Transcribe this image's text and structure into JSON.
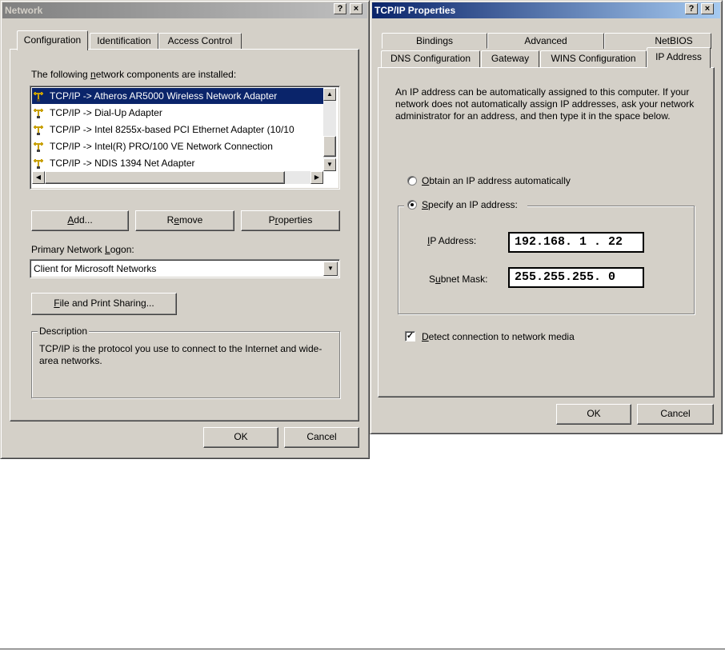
{
  "network": {
    "title": "Network",
    "tabs": [
      "Configuration",
      "Identification",
      "Access Control"
    ],
    "installed_label": "The following network components are installed:",
    "components": [
      "TCP/IP -> Atheros AR5000 Wireless Network Adapter",
      "TCP/IP -> Dial-Up Adapter",
      "TCP/IP -> Intel 8255x-based PCI Ethernet Adapter (10/10",
      "TCP/IP -> Intel(R) PRO/100 VE Network Connection",
      "TCP/IP -> NDIS 1394 Net Adapter"
    ],
    "add_label": "Add...",
    "remove_label": "Remove",
    "properties_label": "Properties",
    "logon_label": "Primary Network Logon:",
    "logon_value": "Client for Microsoft Networks",
    "file_print_label": "File and Print Sharing...",
    "description_legend": "Description",
    "description_text": "TCP/IP is the protocol you use to connect to the Internet and wide-area networks.",
    "ok_label": "OK",
    "cancel_label": "Cancel"
  },
  "tcpip": {
    "title": "TCP/IP Properties",
    "tabs_back": [
      "Bindings",
      "Advanced",
      "NetBIOS"
    ],
    "tabs_front": [
      "DNS Configuration",
      "Gateway",
      "WINS Configuration",
      "IP Address"
    ],
    "intro": "An IP address can be automatically assigned to this computer. If your network does not automatically assign IP addresses, ask your network administrator for an address, and then type it in the space below.",
    "obtain_label": "Obtain an IP address automatically",
    "specify_label": "Specify an IP address:",
    "ip_label": "IP Address:",
    "ip_value": "192.168. 1 . 22",
    "mask_label": "Subnet Mask:",
    "mask_value": "255.255.255. 0",
    "detect_label": "Detect connection to network media",
    "ok_label": "OK",
    "cancel_label": "Cancel"
  },
  "title_buttons": {
    "help": "?",
    "close": "×"
  },
  "colors": {
    "dialog_bg": "#d4d0c8",
    "active_title": "#0a246a",
    "selection": "#0a246a"
  }
}
